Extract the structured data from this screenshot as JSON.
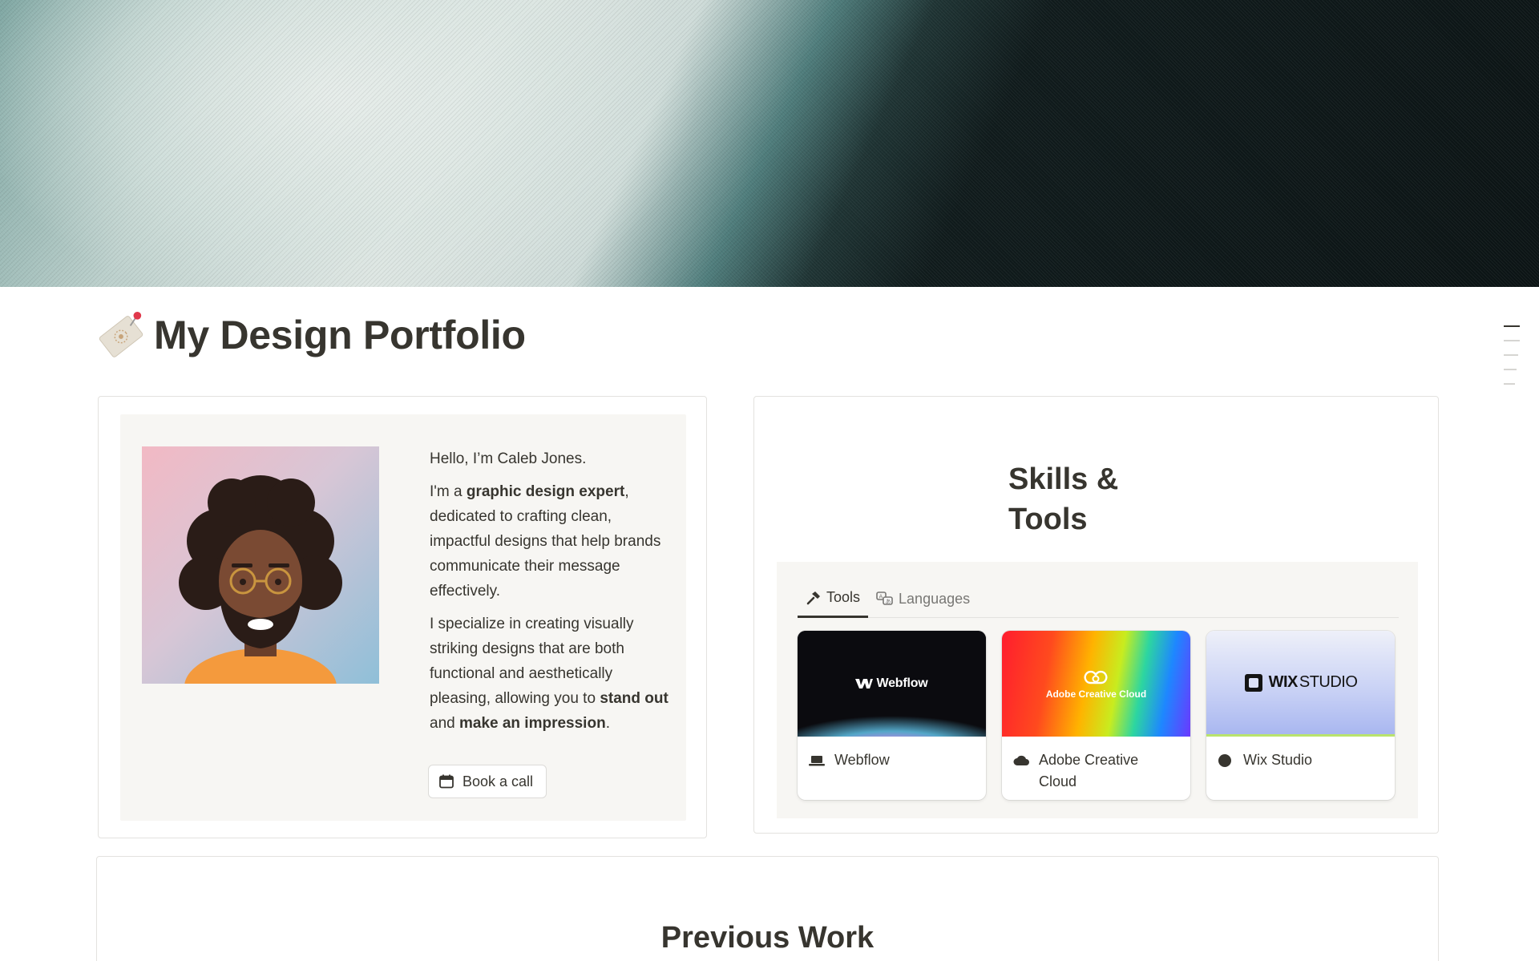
{
  "page": {
    "title": "My Design Portfolio",
    "icon": "tag-pin-icon"
  },
  "about": {
    "greeting": "Hello, I’m Caleb Jones.",
    "p2_pre": "I'm a ",
    "p2_bold": "graphic design expert",
    "p2_post": ", dedicated to crafting clean, impactful designs that help brands communicate their message effectively.",
    "p3_pre": "I specialize in creating visually striking designs that are both functional and aesthetically pleasing, allowing you to ",
    "p3_bold1": "stand out",
    "p3_mid": " and ",
    "p3_bold2": "make an impression",
    "p3_post": ".",
    "button_label": "Book a call",
    "button_icon": "calendar-icon"
  },
  "skills": {
    "heading": "Skills & Tools",
    "tabs": [
      {
        "label": "Tools",
        "icon": "hammer-icon",
        "active": true
      },
      {
        "label": "Languages",
        "icon": "translate-icon",
        "active": false
      }
    ],
    "tools": [
      {
        "name": "Webflow",
        "thumb_text": "Webflow",
        "icon": "laptop-icon"
      },
      {
        "name": "Adobe Creative Cloud",
        "thumb_text": "Adobe Creative Cloud",
        "icon": "cloud-icon"
      },
      {
        "name": "Wix Studio",
        "thumb_text_bold": "WIX",
        "thumb_text": "STUDIO",
        "icon": "circle-icon"
      }
    ]
  },
  "work": {
    "heading": "Previous Work"
  },
  "colors": {
    "text": "#37352f",
    "muted": "#787774",
    "panel": "#f7f6f3",
    "border": "#e3e2df"
  }
}
